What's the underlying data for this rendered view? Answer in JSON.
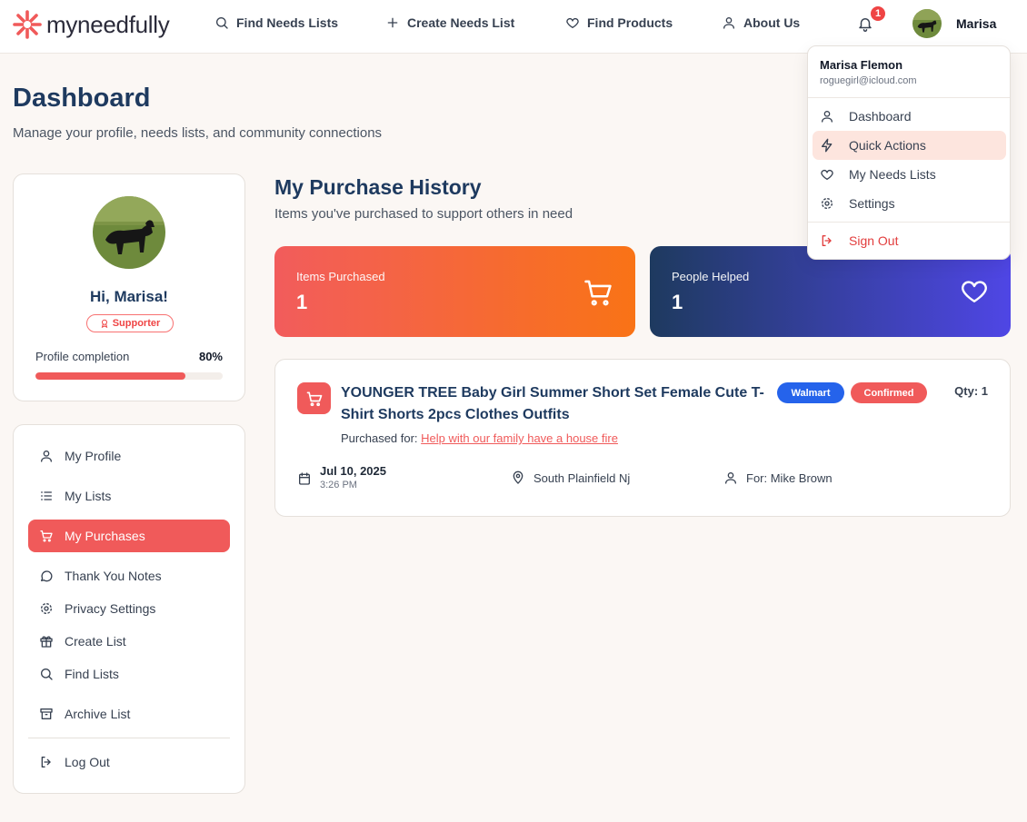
{
  "brand": {
    "name": "myneedfully",
    "color": "#f05a5a"
  },
  "nav": {
    "find_needs": "Find Needs Lists",
    "create_needs": "Create Needs List",
    "find_products": "Find Products",
    "about": "About Us"
  },
  "notifications": {
    "count": "1"
  },
  "user": {
    "first_name": "Marisa",
    "full_name": "Marisa Flemon",
    "email": "roguegirl@icloud.com"
  },
  "page": {
    "title": "Dashboard",
    "subtitle": "Manage your profile, needs lists, and community connections"
  },
  "profile": {
    "greeting": "Hi, Marisa!",
    "badge": "Supporter",
    "completion_label": "Profile completion",
    "completion_value": "80%",
    "completion_fraction": 0.8
  },
  "sidebar": {
    "items": [
      {
        "label": "My Profile",
        "icon": "user-icon"
      },
      {
        "label": "My Lists",
        "icon": "list-icon"
      },
      {
        "label": "My Purchases",
        "icon": "cart-icon",
        "active": true
      },
      {
        "label": "Thank You Notes",
        "icon": "message-icon"
      },
      {
        "label": "Privacy Settings",
        "icon": "gear-icon"
      },
      {
        "label": "Create List",
        "icon": "gift-icon"
      },
      {
        "label": "Find Lists",
        "icon": "search-icon"
      },
      {
        "label": "Archive List",
        "icon": "archive-icon"
      }
    ],
    "logout": "Log Out"
  },
  "purchase_history": {
    "title": "My Purchase History",
    "subtitle": "Items you've purchased to support others in need",
    "stats": [
      {
        "label": "Items Purchased",
        "value": "1",
        "icon": "cart-icon"
      },
      {
        "label": "People Helped",
        "value": "1",
        "icon": "heart-icon"
      }
    ],
    "purchases": [
      {
        "title": "YOUNGER TREE Baby Girl Summer Short Set Female Cute T-Shirt Shorts 2pcs Clothes Outfits",
        "store": "Walmart",
        "status": "Confirmed",
        "qty": "Qty: 1",
        "purchased_for_label": "Purchased for:",
        "purchased_for_link": "Help with our family have a house fire",
        "date": "Jul 10, 2025",
        "time": "3:26 PM",
        "location": "South Plainfield Nj",
        "recipient": "For: Mike Brown"
      }
    ]
  },
  "dropdown": {
    "items": [
      {
        "label": "Dashboard",
        "icon": "user-icon"
      },
      {
        "label": "Quick Actions",
        "icon": "lightning-icon"
      },
      {
        "label": "My Needs Lists",
        "icon": "heart-icon"
      },
      {
        "label": "Settings",
        "icon": "gear-icon"
      }
    ],
    "signout": "Sign Out"
  },
  "colors": {
    "accent": "#f05a5a",
    "navy": "#1e3a5f",
    "walmart_blue": "#2563eb",
    "stat_orange_end": "#f97316",
    "stat_blue_end": "#4f46e5"
  }
}
